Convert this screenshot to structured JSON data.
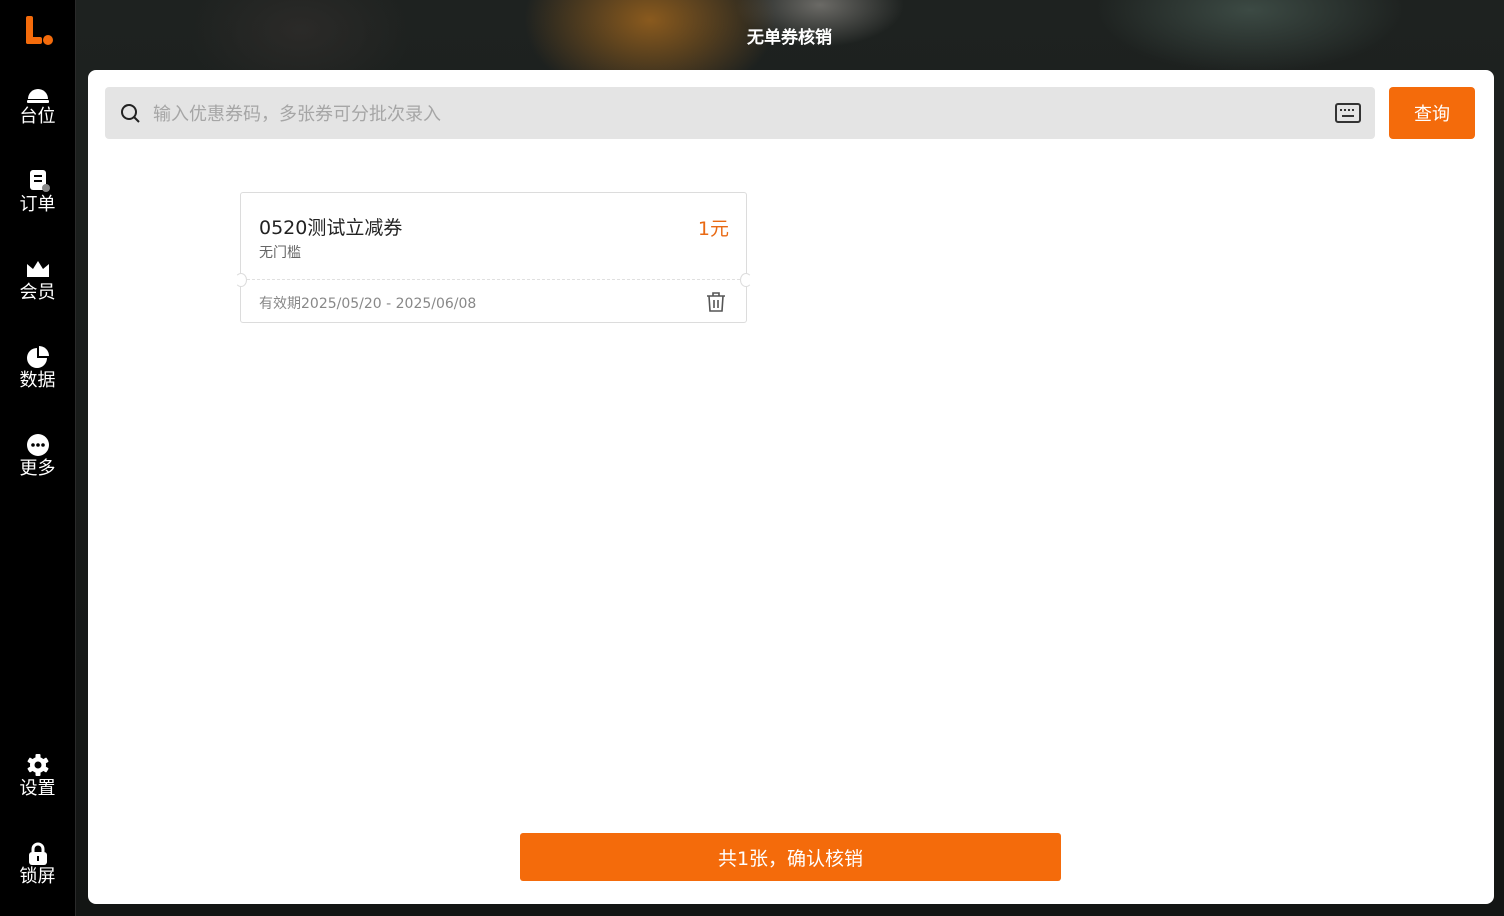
{
  "title": "无单券核销",
  "sidebar": {
    "items": [
      {
        "label": "台位",
        "icon": "table-bell-icon"
      },
      {
        "label": "订单",
        "icon": "order-icon"
      },
      {
        "label": "会员",
        "icon": "member-crown-icon"
      },
      {
        "label": "数据",
        "icon": "pie-chart-icon"
      },
      {
        "label": "更多",
        "icon": "more-icon"
      }
    ],
    "bottom": [
      {
        "label": "设置",
        "icon": "gear-icon"
      },
      {
        "label": "锁屏",
        "icon": "lock-icon"
      }
    ]
  },
  "search": {
    "placeholder": "输入优惠券码，多张券可分批次录入",
    "value": ""
  },
  "query_button": "查询",
  "coupons": [
    {
      "name": "0520测试立减券",
      "amount": "1元",
      "condition": "无门槛",
      "validity": "有效期2025/05/20 - 2025/06/08"
    }
  ],
  "confirm_button": "共1张，确认核销",
  "colors": {
    "accent": "#f46b0b",
    "amount": "#e96a14",
    "sidebar_bg": "#000000",
    "search_bg": "#e4e4e4"
  }
}
